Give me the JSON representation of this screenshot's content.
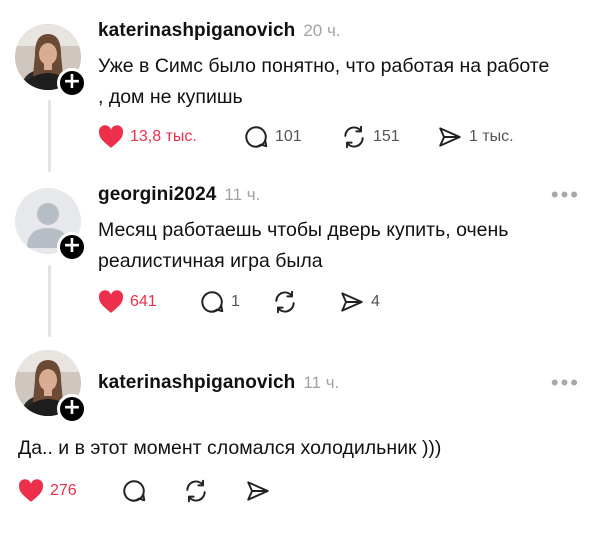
{
  "colors": {
    "like": "#ec2f4b",
    "muted": "#a3a3a3",
    "line": "#e3e3e3"
  },
  "comments": [
    {
      "username": "katerinashpiganovich",
      "time": "20 ч.",
      "text_lines": [
        "Уже в Симс было понятно, что работая на работе",
        ", дом не купишь"
      ],
      "likes": "13,8 тыс.",
      "replies": "101",
      "reposts": "151",
      "shares": "1 тыс.",
      "liked": true,
      "has_more": false
    },
    {
      "username": "georgini2024",
      "time": "11 ч.",
      "text_lines": [
        "Месяц работаешь чтобы дверь купить, очень",
        "реалистичная игра была"
      ],
      "likes": "641",
      "replies": "1",
      "reposts": "",
      "shares": "4",
      "liked": true,
      "has_more": true
    },
    {
      "username": "katerinashpiganovich",
      "time": "11 ч.",
      "text_lines": [
        "Да.. и в этот момент сломался холодильник )))"
      ],
      "likes": "276",
      "replies": "",
      "reposts": "",
      "shares": "",
      "liked": true,
      "has_more": true
    }
  ]
}
